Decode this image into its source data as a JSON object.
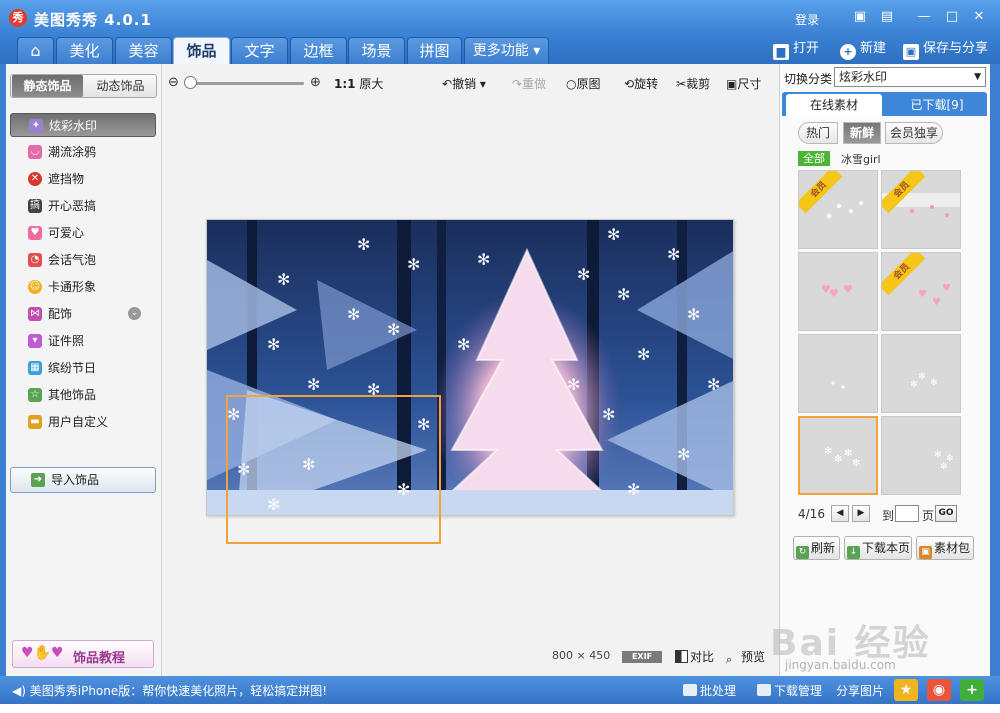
{
  "window": {
    "title": "美图秀秀 4.0.1",
    "login": "登录",
    "logo_glyph": "秀"
  },
  "nav_tabs": [
    {
      "label": "⌂"
    },
    {
      "label": "美化"
    },
    {
      "label": "美容"
    },
    {
      "label": "饰品"
    },
    {
      "label": "文字"
    },
    {
      "label": "边框"
    },
    {
      "label": "场景"
    },
    {
      "label": "拼图"
    },
    {
      "label": "更多功能 ▾"
    }
  ],
  "toolbar": {
    "open": "打开",
    "new": "新建",
    "save_share": "保存与分享"
  },
  "left": {
    "subtabs": [
      "静态饰品",
      "动态饰品"
    ],
    "categories": [
      {
        "label": "炫彩水印",
        "icon": "sparkle-icon",
        "color": "#9b7fd1"
      },
      {
        "label": "潮流涂鸦",
        "icon": "lips-icon",
        "color": "#e56aa8"
      },
      {
        "label": "遮挡物",
        "icon": "mask-icon",
        "color": "#d63a2f"
      },
      {
        "label": "开心恶搞",
        "icon": "prank-icon",
        "color": "#444444"
      },
      {
        "label": "可爱心",
        "icon": "heart-icon",
        "color": "#f06ca0"
      },
      {
        "label": "会话气泡",
        "icon": "speech-bubble-icon",
        "color": "#e05050"
      },
      {
        "label": "卡通形象",
        "icon": "cartoon-icon",
        "color": "#f2b01e"
      },
      {
        "label": "配饰",
        "icon": "bow-icon",
        "color": "#c04fb0"
      },
      {
        "label": "证件照",
        "icon": "shirt-icon",
        "color": "#c05ad0"
      },
      {
        "label": "缤纷节日",
        "icon": "gift-icon",
        "color": "#3ba0d8"
      },
      {
        "label": "其他饰品",
        "icon": "star-outline-icon",
        "color": "#5aa354"
      },
      {
        "label": "用户自定义",
        "icon": "folder-icon",
        "color": "#e0a020"
      }
    ],
    "import_label": "导入饰品",
    "tutorial_label": "饰品教程"
  },
  "edit": {
    "zoom_ratio": "1:1",
    "original_size": "原大",
    "undo": "撤销",
    "redo": "重做",
    "original": "原图",
    "rotate": "旋转",
    "crop": "裁剪",
    "resize": "尺寸",
    "zoom_level": 0.0,
    "image_width": "800",
    "image_height": "450",
    "size_sep": "×",
    "exif": "EXIF",
    "compare": "对比",
    "preview": "预览"
  },
  "right": {
    "switch_label": "切换分类",
    "category_value": "炫彩水印",
    "tab_online": "在线素材",
    "tab_downloaded": "已下载[9]",
    "filters": [
      "热门",
      "新鲜",
      "会员独享"
    ],
    "all_tag": "全部",
    "tag_link": "冰雪girl",
    "member_badge": "会员",
    "page_current": "4/16",
    "goto_label": "到",
    "page_unit": "页",
    "go": "GO",
    "refresh": "刷新",
    "download_page": "下载本页",
    "material_pack": "素材包"
  },
  "status": {
    "message": "美图秀秀iPhone版：帮你快速美化照片，轻松搞定拼图!",
    "batch": "批处理",
    "download_manage": "下载管理",
    "share_photo": "分享图片"
  },
  "watermark": {
    "text": "Bai 经验",
    "sub": "jingyan.baidu.com"
  },
  "colors": {
    "chrome_blue": "#3a7fd0",
    "selection_orange": "#f1a23a",
    "member_gold": "#f5c518",
    "all_green": "#4bb536"
  }
}
